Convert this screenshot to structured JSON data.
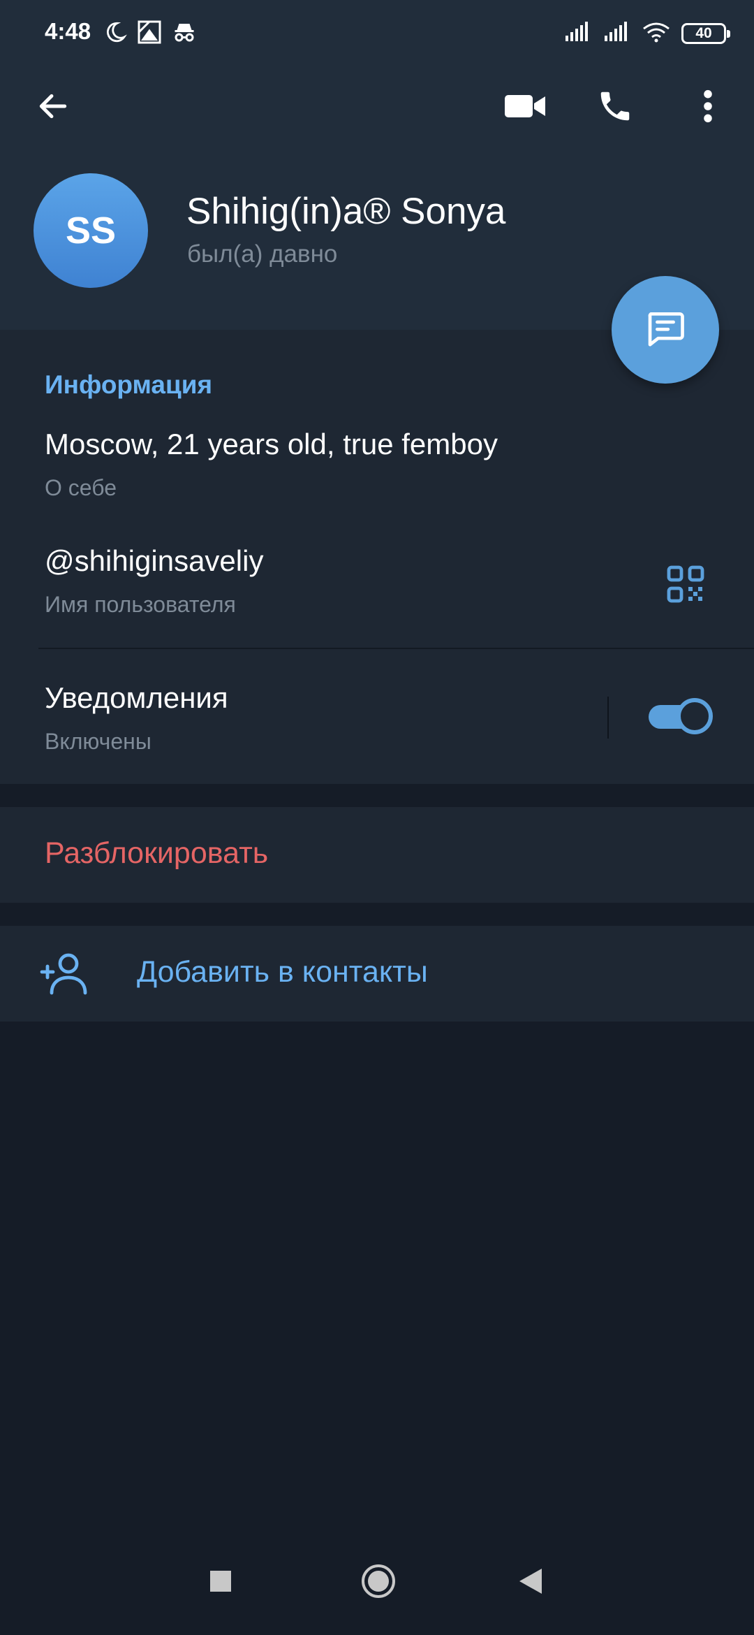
{
  "status_bar": {
    "time": "4:48",
    "battery": "40",
    "left_icons": [
      "moon-icon",
      "image-icon",
      "incognito-icon"
    ],
    "right_icons": [
      "signal-icon",
      "signal-icon",
      "wifi-icon",
      "battery-icon"
    ]
  },
  "toolbar": {
    "back_icon": "arrow-left-icon",
    "video_icon": "video-camera-icon",
    "call_icon": "phone-icon",
    "more_icon": "more-vertical-icon"
  },
  "profile": {
    "avatar_initials": "SS",
    "name": "Shihig(in)a® Sonya",
    "status": "был(а) давно"
  },
  "fab": {
    "icon": "message-icon"
  },
  "info": {
    "title": "Информация",
    "bio_value": "Moscow, 21 years old, true femboy",
    "bio_label": "О себе",
    "username_value": "@shihiginsaveliy",
    "username_label": "Имя пользователя",
    "notifications_value": "Уведомления",
    "notifications_label": "Включены",
    "notifications_enabled": true
  },
  "actions": {
    "unblock": "Разблокировать",
    "add_contact": "Добавить в контакты"
  },
  "colors": {
    "header_bg": "#212d3b",
    "section_bg": "#1e2733",
    "page_bg": "#151c27",
    "accent": "#6ab2f2",
    "danger": "#e56565",
    "muted": "#7f8b98"
  },
  "nav_bar": {
    "recent_icon": "square-icon",
    "home_icon": "circle-icon",
    "back_icon": "triangle-back-icon"
  }
}
